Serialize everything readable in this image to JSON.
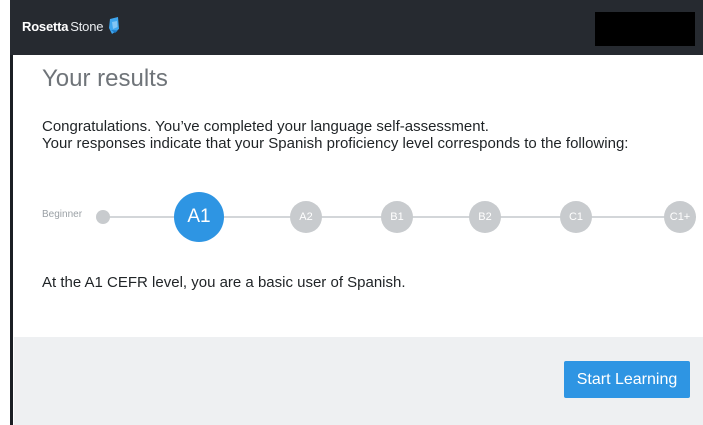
{
  "header": {
    "logo_text_bold": "Rosetta",
    "logo_text_light": "Stone",
    "logo_icon": "rosetta-stone-mark-icon"
  },
  "main": {
    "title": "Your results",
    "intro_line1": "Congratulations. You’ve completed your language self-assessment.",
    "intro_line2": "Your responses indicate that your Spanish proficiency level corresponds to the following:",
    "result_text": "At the A1 CEFR level, you are a basic user of Spanish."
  },
  "levels": {
    "start_label": "Beginner",
    "items": [
      {
        "label": "A1",
        "active": true
      },
      {
        "label": "A2",
        "active": false
      },
      {
        "label": "B1",
        "active": false
      },
      {
        "label": "B2",
        "active": false
      },
      {
        "label": "C1",
        "active": false
      },
      {
        "label": "C1+",
        "active": false
      }
    ]
  },
  "footer": {
    "start_button_label": "Start Learning"
  },
  "colors": {
    "header_bg": "#262a30",
    "accent": "#2e95e3",
    "inactive_node": "#c8cbce",
    "footer_bg": "#eef0f2"
  }
}
